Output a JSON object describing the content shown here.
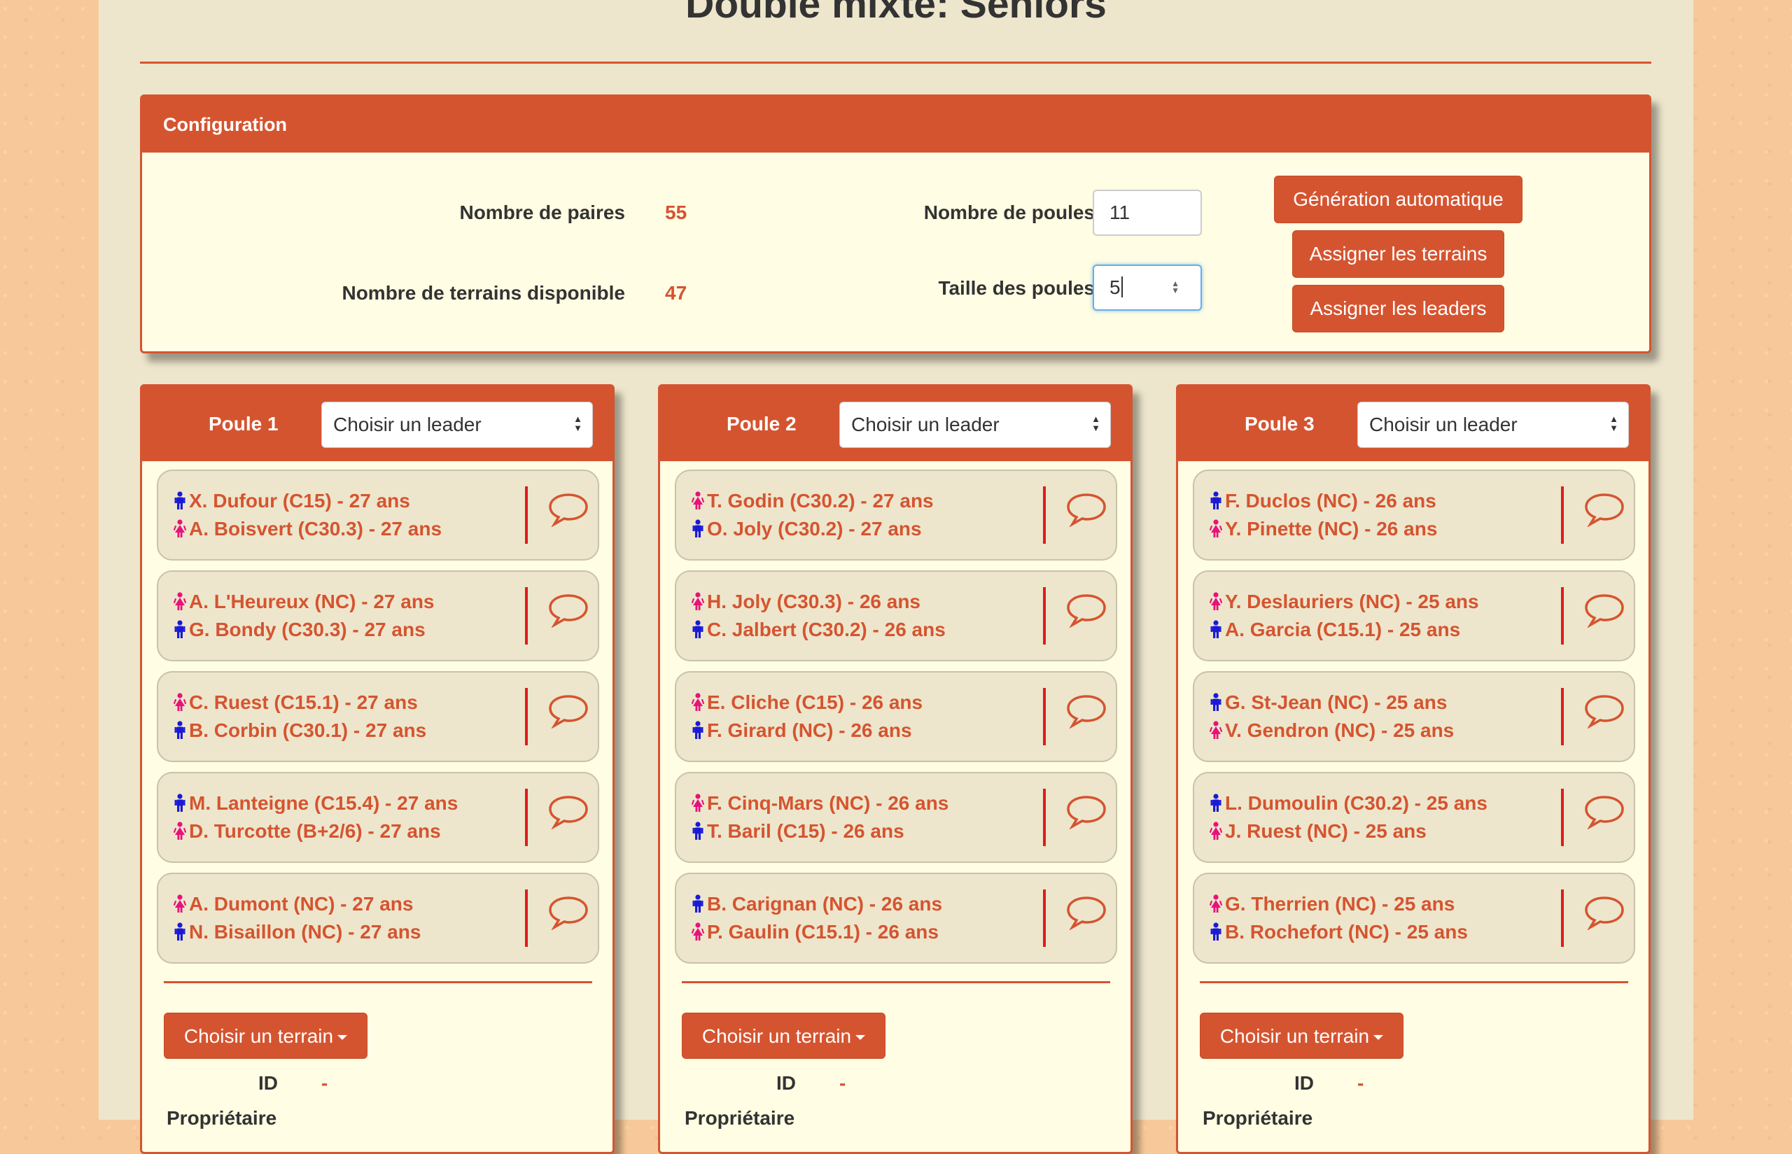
{
  "page": {
    "title": "Double mixte: Seniors"
  },
  "colors": {
    "accent": "#d55430",
    "male": "#1a1ad6",
    "female": "#e8127a",
    "panel_bg": "#fffde3"
  },
  "config": {
    "header": "Configuration",
    "paires_label": "Nombre de paires",
    "paires_value": "55",
    "terrains_label": "Nombre de terrains disponible",
    "terrains_value": "47",
    "poules_label": "Nombre de poules",
    "poules_value": "11",
    "taille_label": "Taille des poules",
    "taille_value": "5",
    "btn_generation": "Génération automatique",
    "btn_terrains": "Assigner les terrains",
    "btn_leaders": "Assigner les leaders"
  },
  "poules": [
    {
      "title": "Poule 1",
      "leader_placeholder": "Choisir un leader",
      "pairs": [
        [
          {
            "gender": "male",
            "text": "X. Dufour (C15) - 27 ans"
          },
          {
            "gender": "female",
            "text": "A. Boisvert (C30.3) - 27 ans"
          }
        ],
        [
          {
            "gender": "female",
            "text": "A. L'Heureux (NC) - 27 ans"
          },
          {
            "gender": "male",
            "text": "G. Bondy (C30.3) - 27 ans"
          }
        ],
        [
          {
            "gender": "female",
            "text": "C. Ruest (C15.1) - 27 ans"
          },
          {
            "gender": "male",
            "text": "B. Corbin (C30.1) - 27 ans"
          }
        ],
        [
          {
            "gender": "male",
            "text": "M. Lanteigne (C15.4) - 27 ans"
          },
          {
            "gender": "female",
            "text": "D. Turcotte (B+2/6) - 27 ans"
          }
        ],
        [
          {
            "gender": "female",
            "text": "A. Dumont (NC) - 27 ans"
          },
          {
            "gender": "male",
            "text": "N. Bisaillon (NC) - 27 ans"
          }
        ]
      ],
      "terrain_button": "Choisir un terrain",
      "id_label": "ID",
      "id_value": "-",
      "proprietaire_label": "Propriétaire"
    },
    {
      "title": "Poule 2",
      "leader_placeholder": "Choisir un leader",
      "pairs": [
        [
          {
            "gender": "female",
            "text": "T. Godin (C30.2) - 27 ans"
          },
          {
            "gender": "male",
            "text": "O. Joly (C30.2) - 27 ans"
          }
        ],
        [
          {
            "gender": "female",
            "text": "H. Joly (C30.3) - 26 ans"
          },
          {
            "gender": "male",
            "text": "C. Jalbert (C30.2) - 26 ans"
          }
        ],
        [
          {
            "gender": "female",
            "text": "E. Cliche (C15) - 26 ans"
          },
          {
            "gender": "male",
            "text": "F. Girard (NC) - 26 ans"
          }
        ],
        [
          {
            "gender": "female",
            "text": "F. Cinq-Mars (NC) - 26 ans"
          },
          {
            "gender": "male",
            "text": "T. Baril (C15) - 26 ans"
          }
        ],
        [
          {
            "gender": "male",
            "text": "B. Carignan (NC) - 26 ans"
          },
          {
            "gender": "female",
            "text": "P. Gaulin (C15.1) - 26 ans"
          }
        ]
      ],
      "terrain_button": "Choisir un terrain",
      "id_label": "ID",
      "id_value": "-",
      "proprietaire_label": "Propriétaire"
    },
    {
      "title": "Poule 3",
      "leader_placeholder": "Choisir un leader",
      "pairs": [
        [
          {
            "gender": "male",
            "text": "F. Duclos (NC) - 26 ans"
          },
          {
            "gender": "female",
            "text": "Y. Pinette (NC) - 26 ans"
          }
        ],
        [
          {
            "gender": "female",
            "text": "Y. Deslauriers (NC) - 25 ans"
          },
          {
            "gender": "male",
            "text": "A. Garcia (C15.1) - 25 ans"
          }
        ],
        [
          {
            "gender": "male",
            "text": "G. St-Jean (NC) - 25 ans"
          },
          {
            "gender": "female",
            "text": "V. Gendron (NC) - 25 ans"
          }
        ],
        [
          {
            "gender": "male",
            "text": "L. Dumoulin (C30.2) - 25 ans"
          },
          {
            "gender": "female",
            "text": "J. Ruest (NC) - 25 ans"
          }
        ],
        [
          {
            "gender": "female",
            "text": "G. Therrien (NC) - 25 ans"
          },
          {
            "gender": "male",
            "text": "B. Rochefort (NC) - 25 ans"
          }
        ]
      ],
      "terrain_button": "Choisir un terrain",
      "id_label": "ID",
      "id_value": "-",
      "proprietaire_label": "Propriétaire"
    }
  ]
}
